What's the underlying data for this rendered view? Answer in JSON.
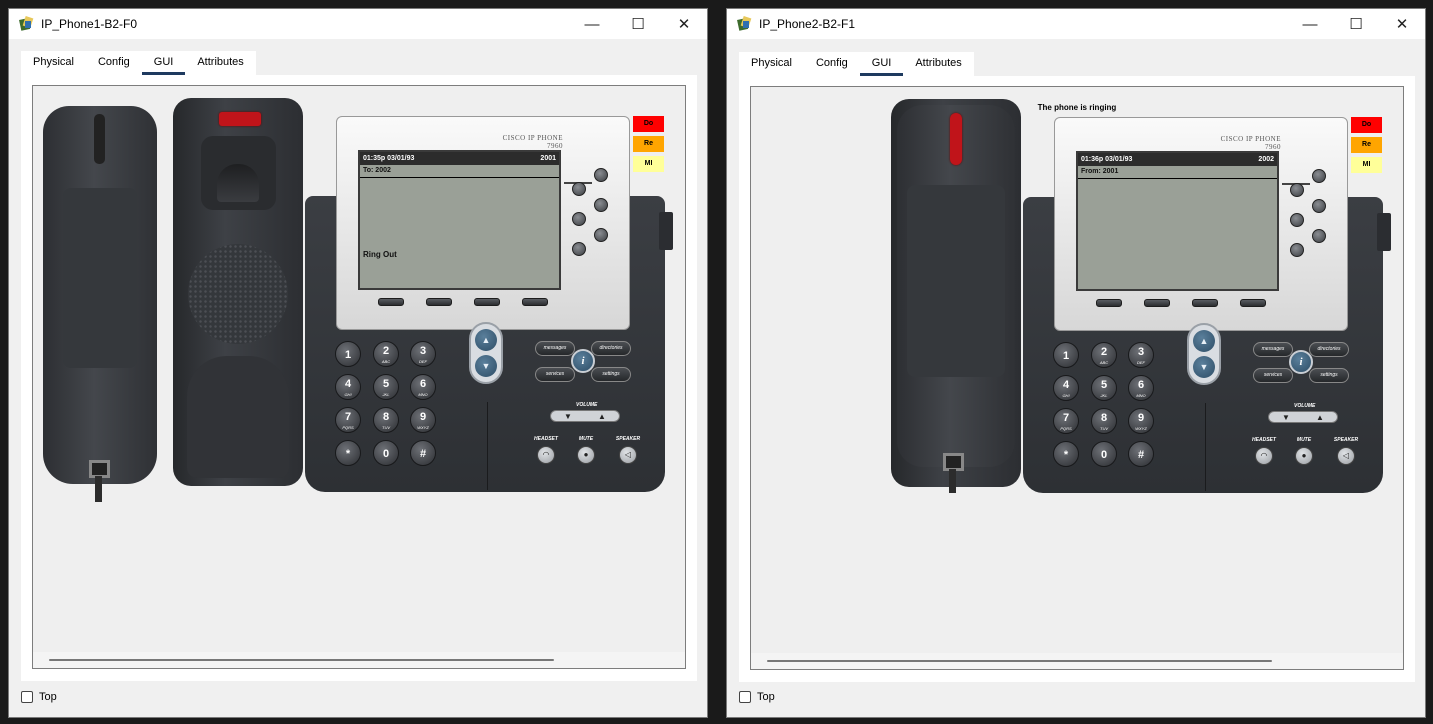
{
  "windows": [
    {
      "title": "IP_Phone1-B2-F0",
      "tabs": [
        "Physical",
        "Config",
        "GUI",
        "Attributes"
      ],
      "active_tab": "GUI",
      "ringing_text": "",
      "screen": {
        "time_date": "01:35p 03/01/93",
        "extension": "2001",
        "line": "To: 2002",
        "status": "Ring Out"
      },
      "brand": "CISCO IP PHONE",
      "model": "7960",
      "status_buttons": [
        "Do",
        "Re",
        "MI"
      ],
      "top_checkbox": "Top"
    },
    {
      "title": "IP_Phone2-B2-F1",
      "tabs": [
        "Physical",
        "Config",
        "GUI",
        "Attributes"
      ],
      "active_tab": "GUI",
      "ringing_text": "The phone is ringing",
      "screen": {
        "time_date": "01:36p 03/01/93",
        "extension": "2002",
        "line": "From: 2001",
        "status": ""
      },
      "brand": "CISCO IP PHONE",
      "model": "7960",
      "status_buttons": [
        "Do",
        "Re",
        "MI"
      ],
      "top_checkbox": "Top"
    }
  ],
  "keypad": [
    {
      "d": "1",
      "l": ""
    },
    {
      "d": "2",
      "l": "ABC"
    },
    {
      "d": "3",
      "l": "DEF"
    },
    {
      "d": "4",
      "l": "GHI"
    },
    {
      "d": "5",
      "l": "JKL"
    },
    {
      "d": "6",
      "l": "MNO"
    },
    {
      "d": "7",
      "l": "PQRS"
    },
    {
      "d": "8",
      "l": "TUV"
    },
    {
      "d": "9",
      "l": "WXYZ"
    },
    {
      "d": "*",
      "l": ""
    },
    {
      "d": "0",
      "l": ""
    },
    {
      "d": "#",
      "l": ""
    }
  ],
  "func_buttons": {
    "messages": "messages",
    "directories": "directories",
    "services": "services",
    "settings": "settings",
    "info": "i"
  },
  "volume_label": "VOLUME",
  "headset_label": "HEADSET",
  "mute_label": "MUTE",
  "speaker_label": "SPEAKER",
  "window_controls": {
    "minimize": "—",
    "maximize": "☐",
    "close": "✕"
  },
  "colors": {
    "do": "#ff0000",
    "re": "#ffa500",
    "mi": "#ffff99",
    "lcd": "#9aa097",
    "red_light": "#c0141a"
  }
}
